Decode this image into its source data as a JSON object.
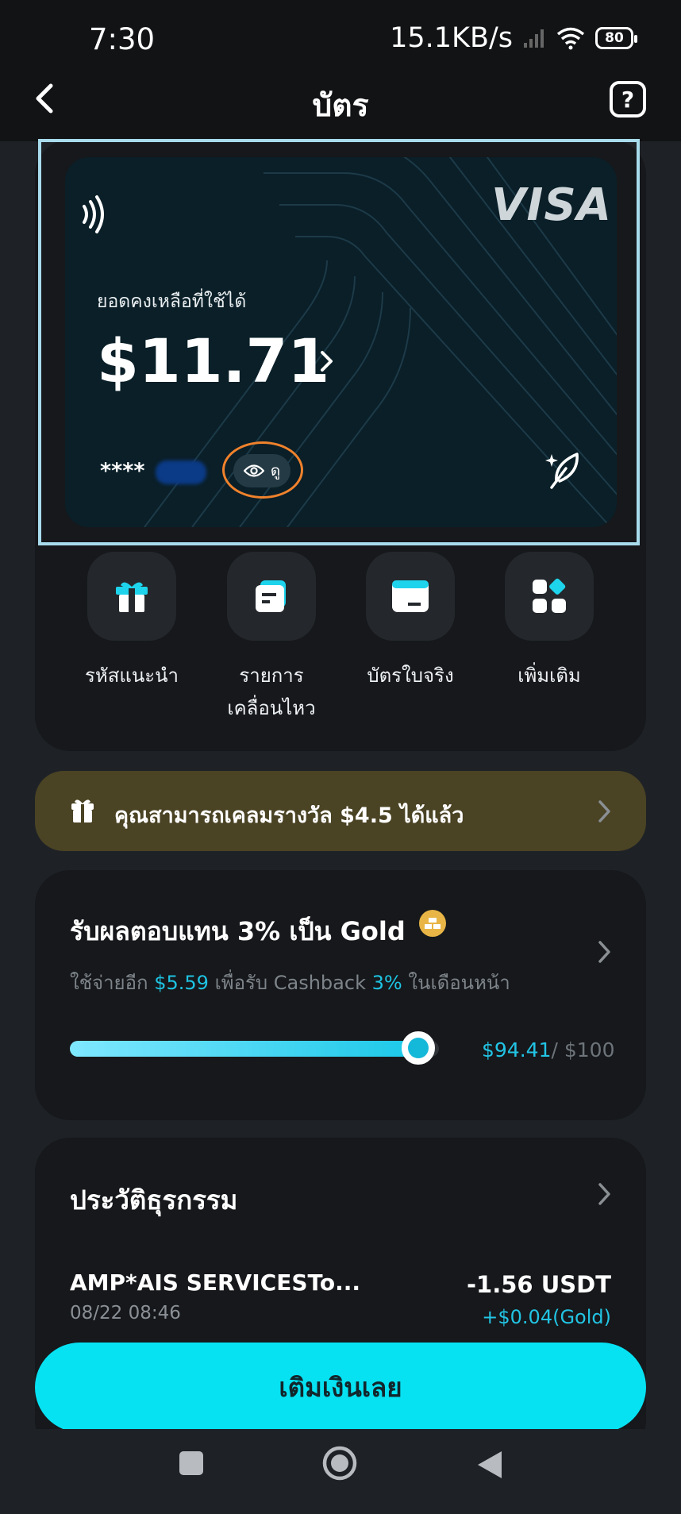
{
  "status_bar": {
    "time": "7:30",
    "speed": "15.1KB/s",
    "battery": "80"
  },
  "header": {
    "title": "บัตร"
  },
  "card": {
    "brand": "VISA",
    "balance_label": "ยอดคงเหลือที่ใช้ได้",
    "balance": "$11.71",
    "masked_number": "****",
    "view_label": "ดู"
  },
  "quick_actions": [
    {
      "label": "รหัสแนะนำ",
      "icon": "gift-icon"
    },
    {
      "label": "รายการเคลื่อนไหว",
      "icon": "transactions-icon"
    },
    {
      "label": "บัตรใบจริง",
      "icon": "physical-card-icon"
    },
    {
      "label": "เพิ่มเติม",
      "icon": "more-grid-icon"
    }
  ],
  "reward_banner": {
    "text": "คุณสามารถเคลมรางวัล $4.5 ได้แล้ว"
  },
  "gold": {
    "title": "รับผลตอบแทน 3% เป็น Gold",
    "sub_prefix": "ใช้จ่ายอีก",
    "sub_amount": "$5.59",
    "sub_mid": "เพื่อรับ Cashback",
    "sub_pct": "3%",
    "sub_suffix": "ในเดือนหน้า",
    "progress_value": "$94.41",
    "progress_max": "/ $100",
    "progress_fraction": 0.9441
  },
  "history": {
    "title": "ประวัติธุรกรรม",
    "transactions": [
      {
        "name": "AMP*AIS SERVICESTo...",
        "date": "08/22 08:46",
        "amount": "-1.56 USDT",
        "cashback": "+$0.04(Gold)"
      }
    ]
  },
  "cta": {
    "label": "เติมเงินเลย"
  },
  "colors": {
    "accent": "#06e2f2",
    "banner": "#4a4324",
    "highlight": "#1ec3e2",
    "annotation": "#f0822c"
  }
}
